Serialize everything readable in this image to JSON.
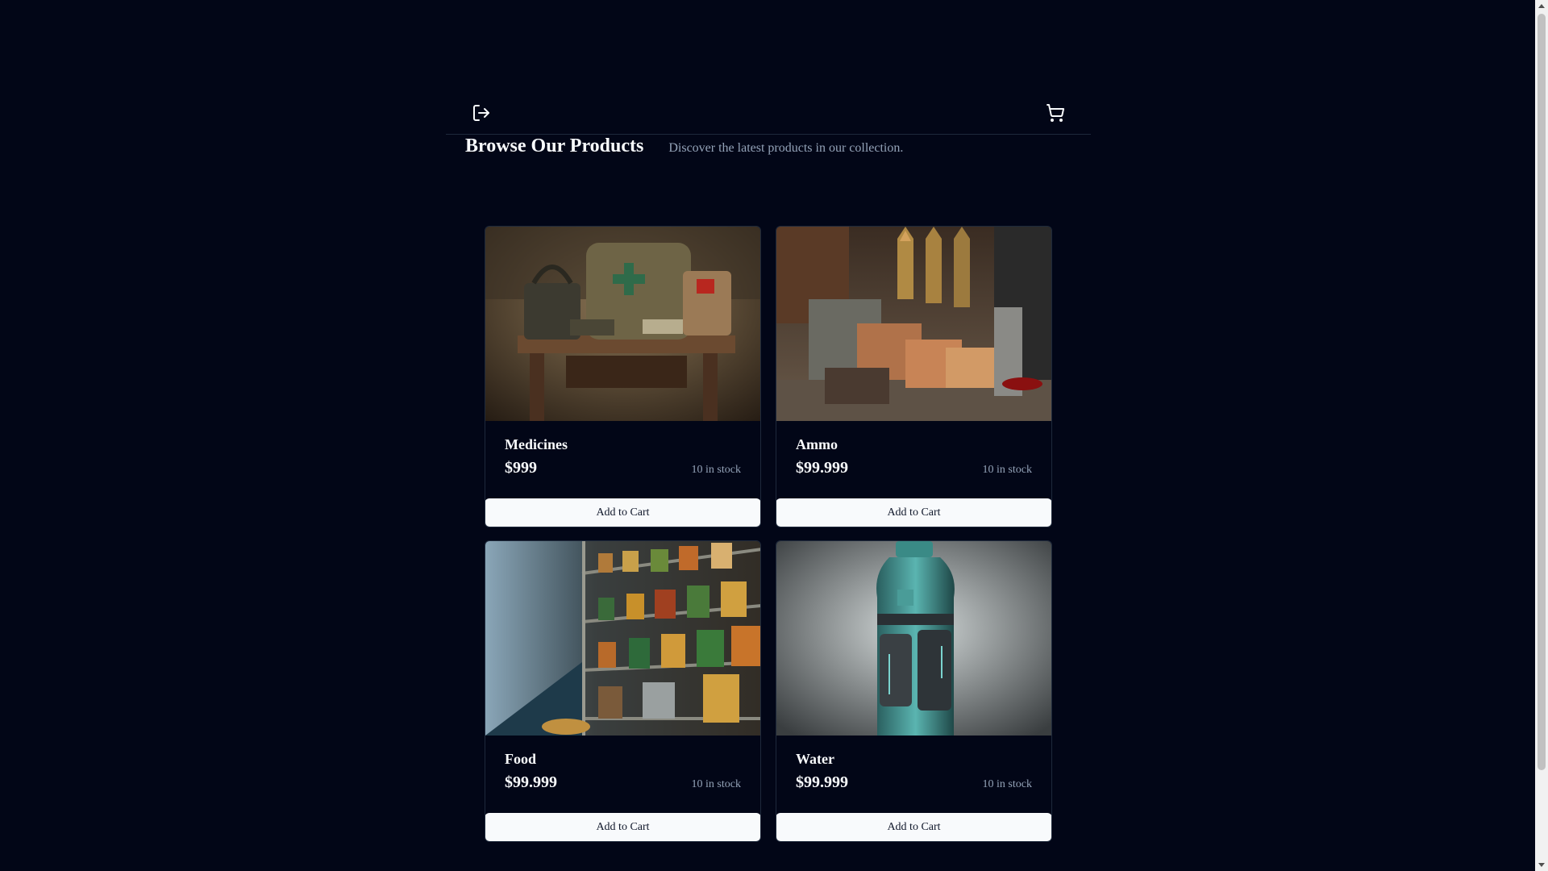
{
  "header": {
    "logout_icon": "logout-icon",
    "cart_icon": "shopping-cart-icon",
    "title": "Browse Our Products",
    "subtitle": "Discover the latest products in our collection."
  },
  "products": [
    {
      "name": "Medicines",
      "price": "$999",
      "stock": "10 in stock",
      "button_label": "Add to Cart",
      "image": "medicine-bags-on-table"
    },
    {
      "name": "Ammo",
      "price": "$99.999",
      "stock": "10 in stock",
      "button_label": "Add to Cart",
      "image": "ammo-crates-and-bullets"
    },
    {
      "name": "Food",
      "price": "$99.999",
      "stock": "10 in stock",
      "button_label": "Add to Cart",
      "image": "canned-food-shelves"
    },
    {
      "name": "Water",
      "price": "$99.999",
      "stock": "10 in stock",
      "button_label": "Add to Cart",
      "image": "armored-water-bottle"
    }
  ],
  "colors": {
    "background": "#020617",
    "card_border": "#1e293b",
    "muted_text": "#94a3b8",
    "button_bg": "#f8fafc",
    "button_text": "#0f172a"
  }
}
